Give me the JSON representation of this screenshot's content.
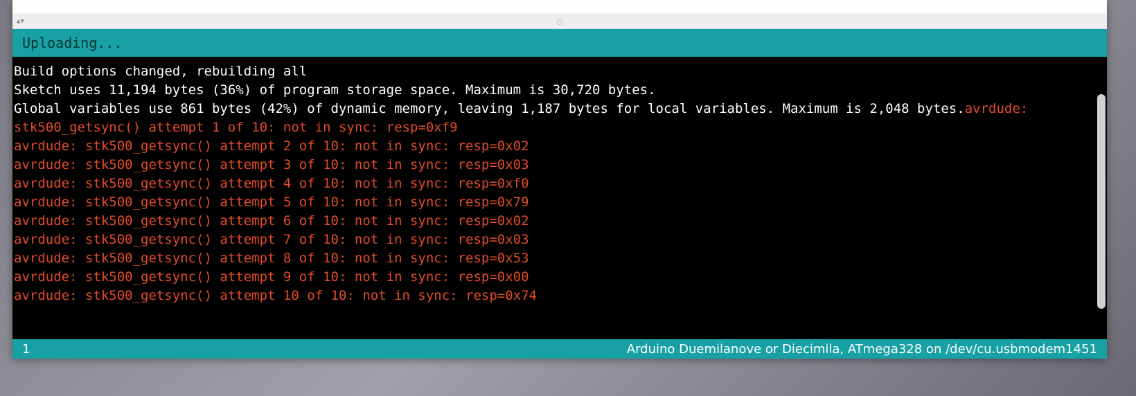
{
  "status": {
    "label": "Uploading..."
  },
  "console": {
    "line1": "Build options changed, rebuilding all",
    "line2": "Sketch uses 11,194 bytes (36%) of program storage space. Maximum is 30,720 bytes.",
    "line3_white": "Global variables use 861 bytes (42%) of dynamic memory, leaving 1,187 bytes for local variables. Maximum is 2,048 bytes.",
    "line3_error": "avrdude: ",
    "err1": "stk500_getsync() attempt 1 of 10: not in sync: resp=0xf9",
    "err2": "avrdude: stk500_getsync() attempt 2 of 10: not in sync: resp=0x02",
    "err3": "avrdude: stk500_getsync() attempt 3 of 10: not in sync: resp=0x03",
    "err4": "avrdude: stk500_getsync() attempt 4 of 10: not in sync: resp=0xf0",
    "err5": "avrdude: stk500_getsync() attempt 5 of 10: not in sync: resp=0x79",
    "err6": "avrdude: stk500_getsync() attempt 6 of 10: not in sync: resp=0x02",
    "err7": "avrdude: stk500_getsync() attempt 7 of 10: not in sync: resp=0x03",
    "err8": "avrdude: stk500_getsync() attempt 8 of 10: not in sync: resp=0x53",
    "err9": "avrdude: stk500_getsync() attempt 9 of 10: not in sync: resp=0x00",
    "err10": "avrdude: stk500_getsync() attempt 10 of 10: not in sync: resp=0x74"
  },
  "footer": {
    "line_number": "1",
    "board_info": "Arduino Duemilanove or Diecimila, ATmega328 on /dev/cu.usbmodem1451"
  }
}
